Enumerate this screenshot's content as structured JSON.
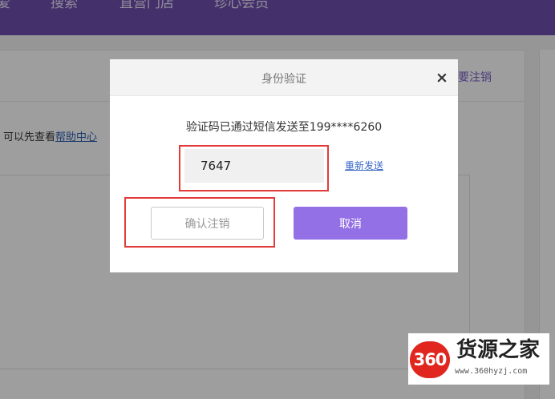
{
  "nav": {
    "items": [
      "爱",
      "搜索",
      "直营门店",
      "珍心会员"
    ]
  },
  "background": {
    "cancel_link": "要注销",
    "help_prefix": "可以先查看",
    "help_link": "帮助中心"
  },
  "modal": {
    "title": "身份验证",
    "close_symbol": "×",
    "sent_message": "验证码已通过短信发送至199****6260",
    "code_value": "7647",
    "resend_label": "重新发送",
    "confirm_label": "确认注销",
    "cancel_label": "取消"
  },
  "watermark": {
    "badge": "360",
    "title": "货源之家",
    "url": "www.360hyzj.com"
  },
  "colors": {
    "nav_bg": "#6e4fae",
    "accent": "#9470e6",
    "highlight": "#e33b3b",
    "link": "#3a67c7"
  }
}
